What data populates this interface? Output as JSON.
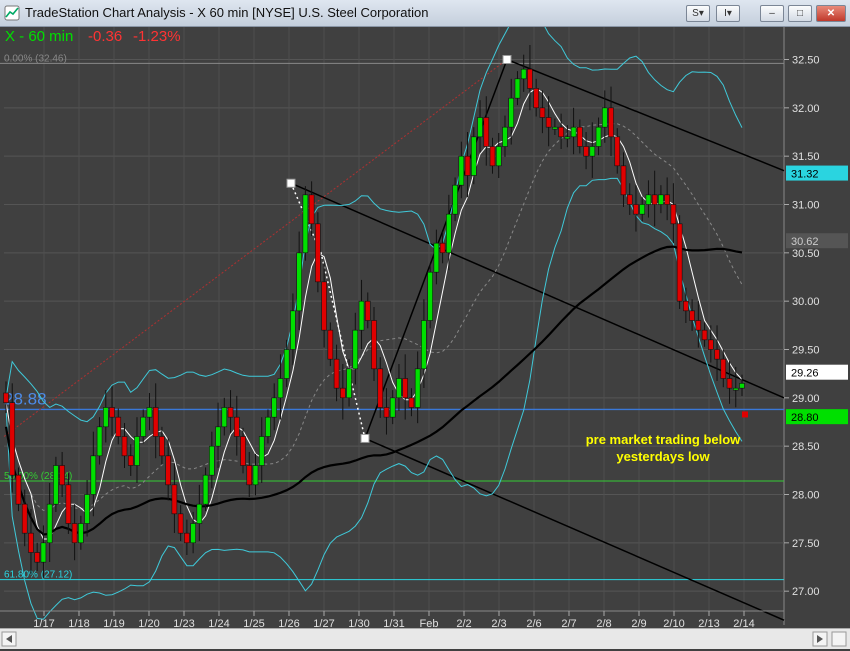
{
  "window": {
    "title": "TradeStation Chart Analysis - X 60 min [NYSE] U.S. Steel Corporation",
    "buttons": {
      "s": "S",
      "i": "I"
    }
  },
  "header": {
    "symbol": "X - 60 min",
    "change": "-0.36",
    "change_pct": "-1.23%"
  },
  "colors": {
    "background": "#404040",
    "up_candle": "#00e000",
    "down_candle": "#e00000",
    "bollinger": "#3fc9d9",
    "ma_fast": "#ffffff",
    "ma_slow": "#000000",
    "support_line": "#3a78d8",
    "fib_line": "#33cc33",
    "fib_618": "#2ad4e0",
    "annotation": "#ffff00",
    "price_red": "#ff3333",
    "price_green": "#00ff00"
  },
  "chart_data": {
    "type": "candlestick",
    "title": "X - 60 min",
    "ylabel": "",
    "ylim": [
      26.65,
      32.65
    ],
    "y_ticks": [
      "32.50",
      "32.00",
      "31.50",
      "31.00",
      "30.50",
      "30.00",
      "29.50",
      "29.00",
      "28.50",
      "28.00",
      "27.50",
      "27.00"
    ],
    "x_ticks": [
      "1/17",
      "1/18",
      "1/19",
      "1/20",
      "1/23",
      "1/24",
      "1/25",
      "1/26",
      "1/27",
      "1/30",
      "1/31",
      "Feb",
      "2/2",
      "2/3",
      "2/6",
      "2/7",
      "2/8",
      "2/9",
      "2/10",
      "2/13",
      "2/14"
    ],
    "price_labels": [
      {
        "label": "31.32",
        "value": 31.32,
        "style": "cyan"
      },
      {
        "label": "30.62",
        "value": 30.62,
        "style": "gray"
      },
      {
        "label": "29.26",
        "value": 29.26,
        "style": "white"
      },
      {
        "label": "28.80",
        "value": 28.8,
        "style": "green"
      }
    ],
    "horizontal_lines": [
      {
        "label": "28.88",
        "value": 28.88,
        "style": "blue"
      },
      {
        "label": "50.00% (28.14)",
        "value": 28.14,
        "style": "green"
      },
      {
        "label": "61.80% (27.12)",
        "value": 27.12,
        "style": "cyan"
      },
      {
        "label": "0.00% (32.46)",
        "value": 32.46,
        "style": "gray"
      }
    ],
    "annotation": {
      "line1": "pre market trading below",
      "line2": "yesterdays low"
    },
    "pivots": [
      {
        "x": "1/26",
        "value": 31.22
      },
      {
        "x": "1/30",
        "value": 28.58
      },
      {
        "x": "2/3",
        "value": 32.5
      }
    ],
    "closes": [
      28.95,
      28.2,
      27.9,
      27.6,
      27.4,
      27.3,
      27.5,
      27.9,
      28.3,
      28.1,
      27.7,
      27.5,
      27.7,
      28.0,
      28.4,
      28.7,
      28.9,
      28.8,
      28.6,
      28.4,
      28.3,
      28.6,
      28.8,
      28.9,
      28.6,
      28.4,
      28.1,
      27.8,
      27.6,
      27.5,
      27.7,
      27.9,
      28.2,
      28.5,
      28.7,
      28.9,
      28.8,
      28.6,
      28.3,
      28.1,
      28.3,
      28.6,
      28.8,
      29.0,
      29.2,
      29.5,
      29.9,
      30.5,
      31.1,
      30.8,
      30.2,
      29.7,
      29.4,
      29.1,
      29.0,
      29.3,
      29.7,
      30.0,
      29.8,
      29.3,
      28.9,
      28.8,
      29.0,
      29.2,
      29.0,
      28.9,
      29.3,
      29.8,
      30.3,
      30.6,
      30.5,
      30.9,
      31.2,
      31.5,
      31.3,
      31.7,
      31.9,
      31.6,
      31.4,
      31.6,
      31.8,
      32.1,
      32.3,
      32.4,
      32.2,
      32.0,
      31.9,
      31.8,
      31.8,
      31.7,
      31.7,
      31.8,
      31.6,
      31.5,
      31.6,
      31.8,
      32.0,
      31.7,
      31.4,
      31.1,
      31.0,
      30.9,
      31.0,
      31.1,
      31.0,
      31.1,
      31.0,
      30.8,
      30.0,
      29.9,
      29.8,
      29.7,
      29.6,
      29.5,
      29.4,
      29.2,
      29.1,
      29.1,
      29.15
    ]
  }
}
